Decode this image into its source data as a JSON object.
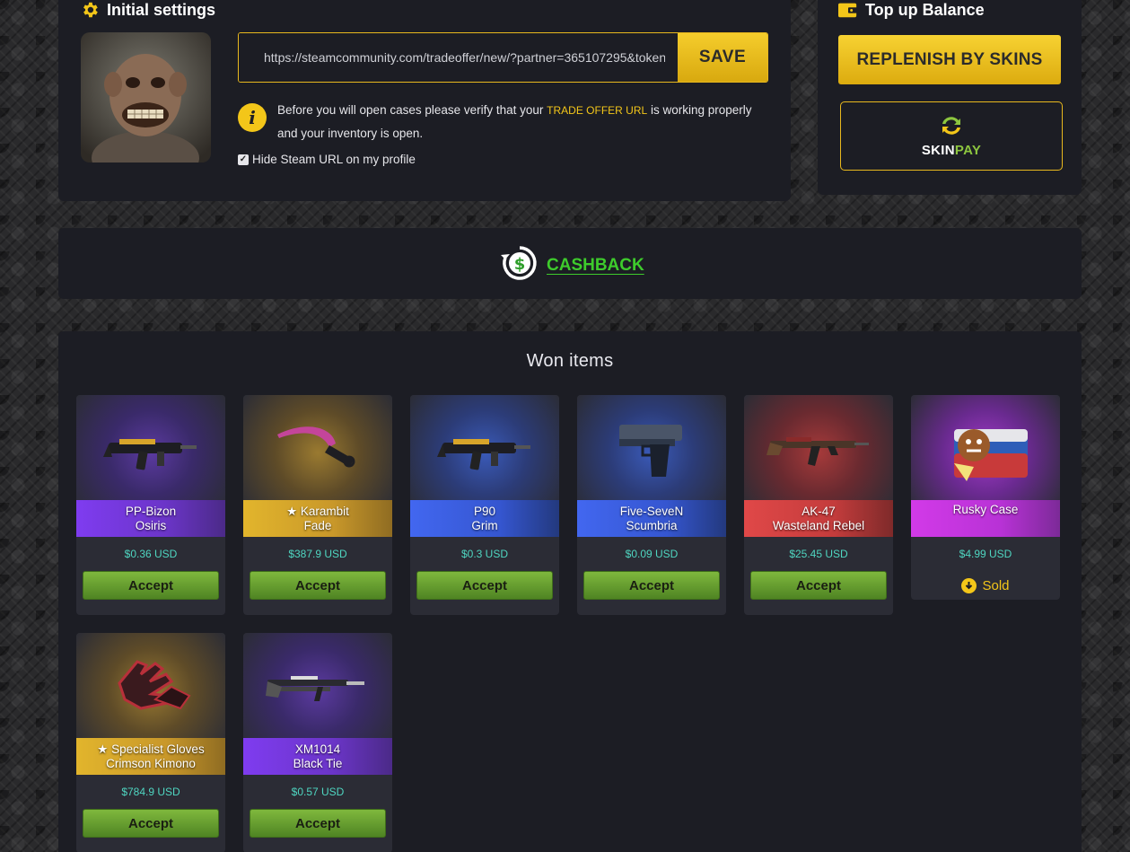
{
  "settings": {
    "title": "Initial settings",
    "trade_url": "https://steamcommunity.com/tradeoffer/new/?partner=365107295&token=",
    "save_label": "SAVE",
    "info_before": "Before you will open cases please verify that your ",
    "info_highlight": "TRADE OFFER URL",
    "info_after": " is working properly and your inventory is open.",
    "hide_label": "Hide Steam URL on my profile",
    "hide_checked": true
  },
  "topup": {
    "title": "Top up Balance",
    "replenish_label": "REPLENISH BY SKINS",
    "skinpay_skin": "SKIN",
    "skinpay_pay": "PAY"
  },
  "cashback": {
    "label": "CASHBACK"
  },
  "won": {
    "title": "Won items",
    "items": [
      {
        "line1": "PP-Bizon",
        "line2": "Osiris",
        "price": "$0.36 USD",
        "action": "Accept",
        "rarity": "purple",
        "icon": "smg-icon"
      },
      {
        "line1": "★ Karambit",
        "line2": "Fade",
        "price": "$387.9 USD",
        "action": "Accept",
        "rarity": "gold",
        "icon": "knife-icon"
      },
      {
        "line1": "P90",
        "line2": "Grim",
        "price": "$0.3 USD",
        "action": "Accept",
        "rarity": "blue",
        "icon": "smg-icon"
      },
      {
        "line1": "Five-SeveN",
        "line2": "Scumbria",
        "price": "$0.09 USD",
        "action": "Accept",
        "rarity": "blue",
        "icon": "pistol-icon"
      },
      {
        "line1": "AK-47",
        "line2": "Wasteland Rebel",
        "price": "$25.45 USD",
        "action": "Accept",
        "rarity": "red",
        "icon": "rifle-icon"
      },
      {
        "line1": "Rusky Case",
        "line2": "",
        "price": "$4.99 USD",
        "action": "Sold",
        "rarity": "pink",
        "icon": "case-icon"
      },
      {
        "line1": "★ Specialist Gloves",
        "line2": "Crimson Kimono",
        "price": "$784.9 USD",
        "action": "Accept",
        "rarity": "gold",
        "icon": "gloves-icon"
      },
      {
        "line1": "XM1014",
        "line2": "Black Tie",
        "price": "$0.57 USD",
        "action": "Accept",
        "rarity": "purple",
        "icon": "shotgun-icon"
      }
    ]
  },
  "colors": {
    "accent": "#f3c619",
    "cashback": "#3ecb2c",
    "price": "#4fd6c1",
    "accept": "#6ea534",
    "rarity_purple": "#7c3ae0",
    "rarity_gold": "#d6a52a",
    "rarity_blue": "#3e63e8",
    "rarity_red": "#d64545",
    "rarity_pink": "#c837e0"
  }
}
